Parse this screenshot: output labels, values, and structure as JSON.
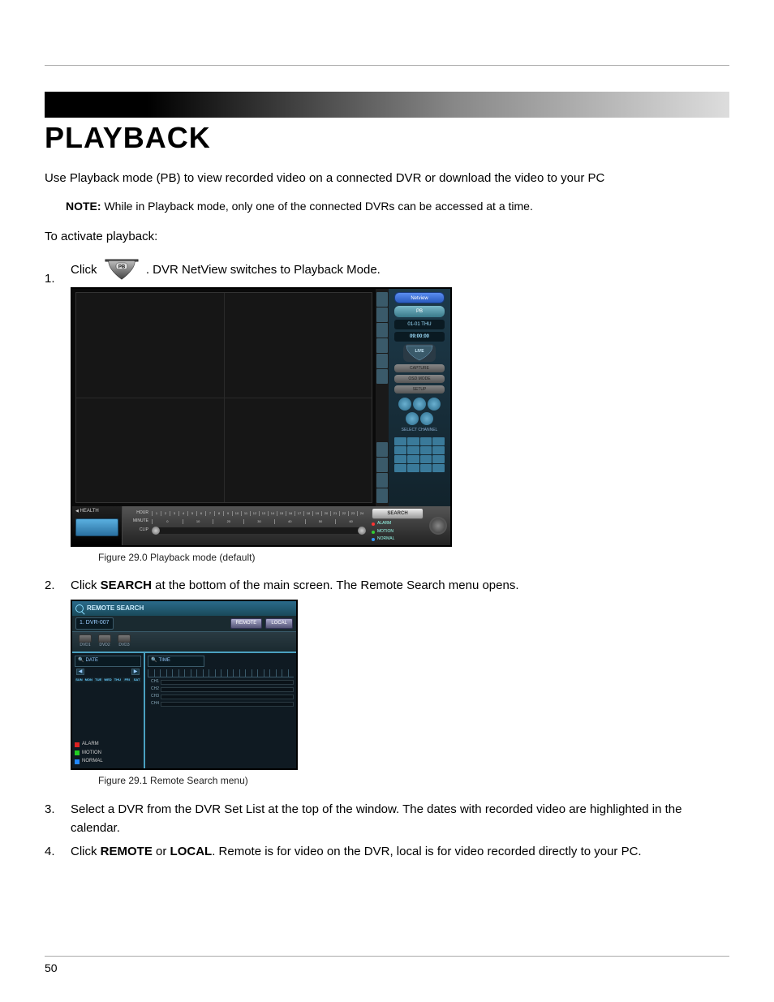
{
  "page_number": "50",
  "heading": "PLAYBACK",
  "intro": "Use Playback mode (PB) to view recorded video on a connected DVR or download the video to your PC",
  "note_label": "NOTE:",
  "note_text": " While in Playback mode, only one of the connected DVRs can be accessed at a time.",
  "activate_label": "To activate playback:",
  "steps": {
    "s1_pre": "Click ",
    "s1_post": ". DVR NetView switches to Playback Mode.",
    "s2_pre": "Click ",
    "s2_bold": "SEARCH",
    "s2_post": " at the bottom of the main screen. The Remote Search menu opens.",
    "s3": "Select a DVR from the DVR Set List at the top of the window. The dates with recorded video are highlighted in the calendar.",
    "s4_pre": "Click ",
    "s4_b1": "REMOTE",
    "s4_mid": " or ",
    "s4_b2": "LOCAL",
    "s4_post": ". Remote is for video on the DVR, local is for video recorded directly to your PC."
  },
  "fig1_caption": "Figure 29.0 Playback mode (default)",
  "fig2_caption": "Figure 29.1 Remote Search menu)",
  "pb_icon_label": "PB",
  "shot1": {
    "brand": "Netview",
    "pb": "PB",
    "date": "01-01  THU",
    "time": "09:00:00",
    "live": "LIVE",
    "capture": "CAPTURE",
    "osd": "OSD MODE",
    "setup": "SETUP",
    "select_channel": "SELECT CHANNEL",
    "health": "HEALTH",
    "hour": "HOUR",
    "minute": "MINUTE",
    "clip": "CLIP",
    "search": "SEARCH",
    "alarm": "ALARM",
    "motion": "MOTION",
    "normal": "NORMAL",
    "hours": [
      "1",
      "2",
      "3",
      "4",
      "5",
      "6",
      "7",
      "8",
      "9",
      "10",
      "11",
      "12",
      "13",
      "14",
      "15",
      "16",
      "17",
      "18",
      "19",
      "20",
      "21",
      "22",
      "23",
      "24"
    ],
    "minutes_ticks": [
      "0",
      "10",
      "20",
      "30",
      "40",
      "50",
      "60"
    ]
  },
  "shot2": {
    "title": "REMOTE SEARCH",
    "dvr_set": "1. DVR-007",
    "remote": "REMOTE",
    "local": "LOCAL",
    "drives": [
      "DVD1",
      "DVD2",
      "DVD3"
    ],
    "date_hdr": "DATE",
    "time_hdr": "TIME",
    "week": [
      "SUN",
      "MON",
      "TUE",
      "WED",
      "THU",
      "FRI",
      "SAT"
    ],
    "legend_alarm": "ALARM",
    "legend_motion": "MOTION",
    "legend_normal": "NORMAL",
    "channels": [
      "CH1",
      "CH2",
      "CH3",
      "CH4"
    ]
  }
}
